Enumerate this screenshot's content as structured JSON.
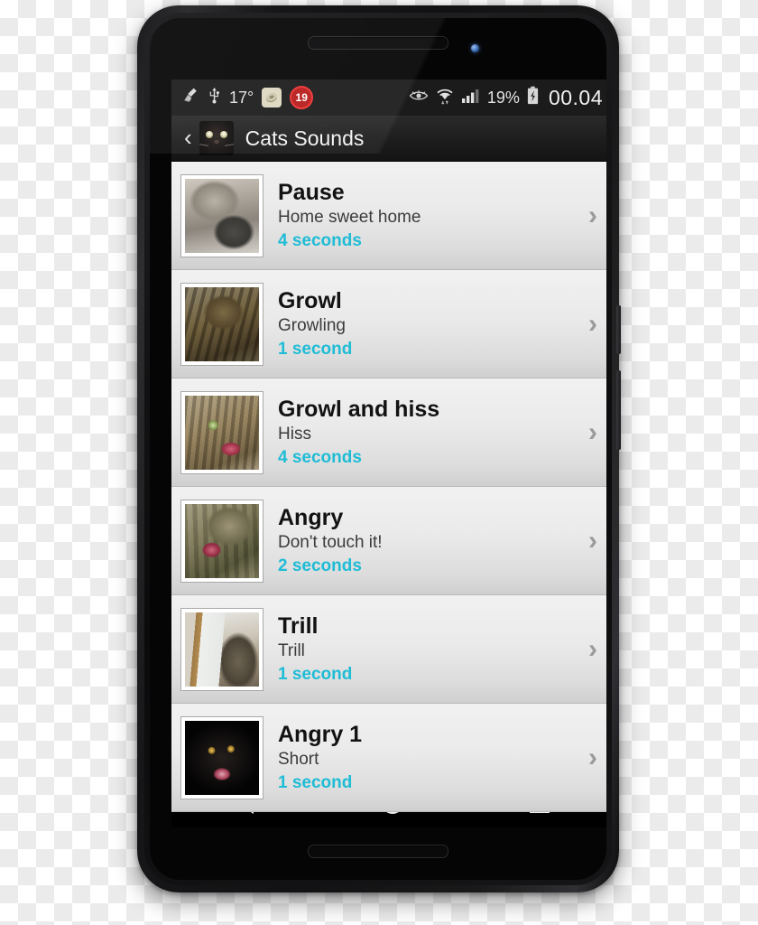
{
  "status_bar": {
    "left_icons": [
      {
        "name": "cleaner-broom-icon",
        "glyph": "☄"
      },
      {
        "name": "usb-icon",
        "glyph": "⚷"
      },
      {
        "name": "temperature-label",
        "glyph": ""
      },
      {
        "name": "app-tile-icon",
        "glyph": "◔"
      },
      {
        "name": "notification-count-badge",
        "glyph": ""
      }
    ],
    "temperature": "17°",
    "notification_count": "19",
    "eye_icon": "eye-icon",
    "wifi_icon": "wifi-icon",
    "signal_icon": "cellular-signal-icon",
    "battery_percent": "19%",
    "battery_icon": "battery-charging-icon",
    "clock": "00.04"
  },
  "action_bar": {
    "back_label": "‹",
    "app_icon_name": "cats-sounds-app-icon",
    "title": "Cats Sounds"
  },
  "list": {
    "chevron_glyph": "›",
    "items": [
      {
        "title": "Pause",
        "subtitle": "Home sweet home",
        "duration": "4 seconds",
        "thumb_name": "thumbnail-pause",
        "thumb_class": "cat-pause"
      },
      {
        "title": "Growl",
        "subtitle": "Growling",
        "duration": "1 second",
        "thumb_name": "thumbnail-growl",
        "thumb_class": "cat-growl"
      },
      {
        "title": "Growl and hiss",
        "subtitle": "Hiss",
        "duration": "4 seconds",
        "thumb_name": "thumbnail-growl-and-hiss",
        "thumb_class": "cat-hiss"
      },
      {
        "title": "Angry",
        "subtitle": "Don't touch it!",
        "duration": "2 seconds",
        "thumb_name": "thumbnail-angry",
        "thumb_class": "cat-angry"
      },
      {
        "title": "Trill",
        "subtitle": "Trill",
        "duration": "1 second",
        "thumb_name": "thumbnail-trill",
        "thumb_class": "cat-trill"
      },
      {
        "title": "Angry 1",
        "subtitle": "Short",
        "duration": "1 second",
        "thumb_name": "thumbnail-angry-1",
        "thumb_class": "cat-angry1"
      }
    ]
  },
  "nav_bar": {
    "back": "navigation-back-button",
    "home": "navigation-home-button",
    "recents": "navigation-recents-button"
  },
  "colors": {
    "accent_duration": "#1fbcd6",
    "status_bar_bg": "#1b1b1b",
    "action_bar_bg": "#1d1d1d",
    "badge_red": "#b71c1c"
  }
}
